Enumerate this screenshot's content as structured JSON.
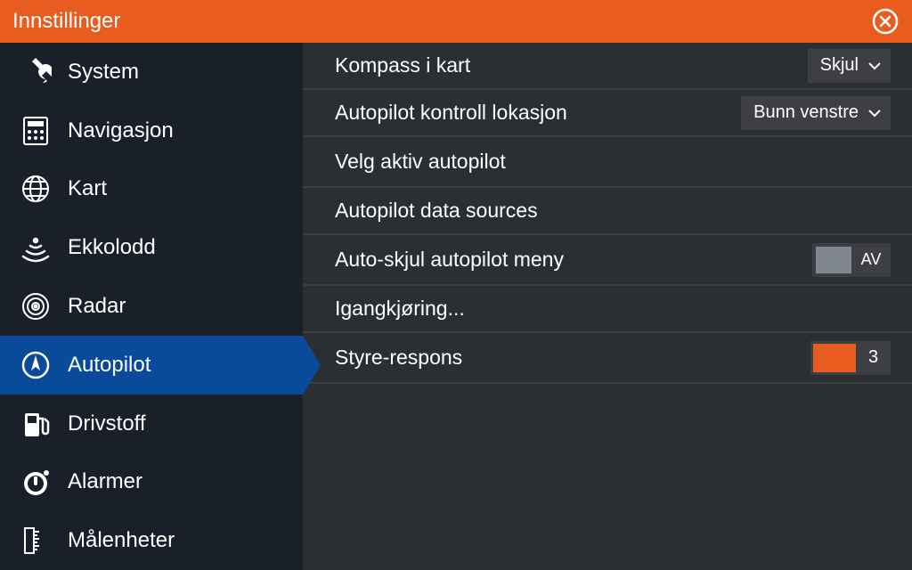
{
  "header": {
    "title": "Innstillinger"
  },
  "sidebar": {
    "items": [
      {
        "label": "System"
      },
      {
        "label": "Navigasjon"
      },
      {
        "label": "Kart"
      },
      {
        "label": "Ekkolodd"
      },
      {
        "label": "Radar"
      },
      {
        "label": "Autopilot"
      },
      {
        "label": "Drivstoff"
      },
      {
        "label": "Alarmer"
      },
      {
        "label": "Målenheter"
      }
    ]
  },
  "content": {
    "compass": {
      "label": "Kompass i kart",
      "value": "Skjul"
    },
    "location": {
      "label": "Autopilot kontroll lokasjon",
      "value": "Bunn venstre"
    },
    "select_active": {
      "label": "Velg aktiv autopilot"
    },
    "data_sources": {
      "label": "Autopilot data sources"
    },
    "autohide": {
      "label": "Auto-skjul autopilot meny",
      "value": "AV"
    },
    "commissioning": {
      "label": "Igangkjøring..."
    },
    "response": {
      "label": "Styre-respons",
      "value": "3"
    }
  }
}
